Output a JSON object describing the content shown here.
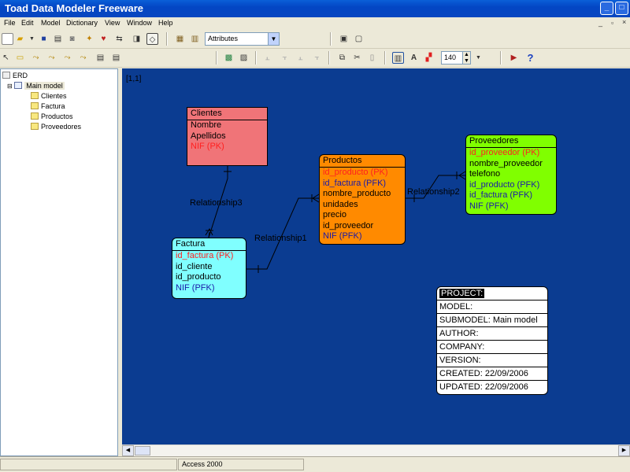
{
  "window": {
    "title": "Toad Data Modeler Freeware"
  },
  "menu": [
    "File",
    "Edit",
    "Model",
    "Dictionary",
    "View",
    "Window",
    "Help"
  ],
  "toolbar": {
    "attribute_combo": "Attributes",
    "zoom_value": "140"
  },
  "tree": {
    "root": "ERD",
    "model": "Main model",
    "entities": [
      "Clientes",
      "Factura",
      "Productos",
      "Proveedores"
    ]
  },
  "canvas": {
    "page_label": "[1,1]",
    "entities": {
      "clientes": {
        "name": "Clientes",
        "attrs": [
          {
            "text": "Nombre",
            "color": "#000000"
          },
          {
            "text": "Apellidos",
            "color": "#000000"
          },
          {
            "text": "NIF (PK)",
            "color": "#ff2020"
          }
        ]
      },
      "productos": {
        "name": "Productos",
        "attrs": [
          {
            "text": "id_producto (PK)",
            "color": "#ff2020"
          },
          {
            "text": "id_factura (PFK)",
            "color": "#1a1aa8"
          },
          {
            "text": "nombre_producto",
            "color": "#000000"
          },
          {
            "text": "unidades",
            "color": "#000000"
          },
          {
            "text": "precio",
            "color": "#000000"
          },
          {
            "text": "id_proveedor",
            "color": "#000000"
          },
          {
            "text": "NIF (PFK)",
            "color": "#1a1aa8"
          }
        ]
      },
      "proveedores": {
        "name": "Proveedores",
        "attrs": [
          {
            "text": "id_proveedor (PK)",
            "color": "#ff2020"
          },
          {
            "text": "nombre_proveedor",
            "color": "#000000"
          },
          {
            "text": "telefono",
            "color": "#000000"
          },
          {
            "text": "id_producto (PFK)",
            "color": "#1a1aa8"
          },
          {
            "text": "id_factura (PFK)",
            "color": "#1a1aa8"
          },
          {
            "text": "NIF (PFK)",
            "color": "#1a1aa8"
          }
        ]
      },
      "factura": {
        "name": "Factura",
        "attrs": [
          {
            "text": "id_factura (PK)",
            "color": "#ff2020"
          },
          {
            "text": "id_cliente",
            "color": "#000000"
          },
          {
            "text": "id_producto",
            "color": "#000000"
          },
          {
            "text": "NIF (PFK)",
            "color": "#1a1aa8"
          }
        ]
      }
    },
    "relationships": [
      "Relationship3",
      "Relationship1",
      "Relationship2"
    ],
    "project_box": [
      "PROJECT:",
      "MODEL:",
      "SUBMODEL: Main model",
      "AUTHOR:",
      "COMPANY:",
      "VERSION:",
      "CREATED: 22/09/2006",
      "UPDATED: 22/09/2006"
    ]
  },
  "colors": {
    "canvas": "#0b3c91",
    "clientes": "#f07478",
    "productos": "#ff8a00",
    "proveedores": "#80ff00",
    "factura": "#80ffff"
  },
  "status": {
    "db": "Access 2000"
  }
}
